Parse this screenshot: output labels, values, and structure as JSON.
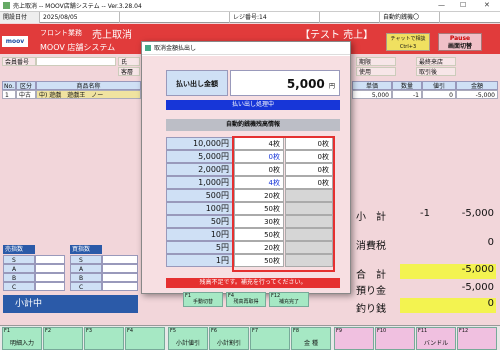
{
  "window": {
    "title": "売上取消 -- MOOV店舗システム -- Ver.3.28.04",
    "min": "—",
    "max": "☐",
    "close": "✕"
  },
  "infobar": {
    "date_label": "開設日付",
    "date": "2025/08/05",
    "register": "レジ番号:14",
    "atm_status": "自動釣銭機〇"
  },
  "header": {
    "logo": "moov",
    "dept": "フロント業務",
    "screen": "売上取消",
    "system": "MOOV 店舗システム",
    "test_label": "【テスト 売上】",
    "chat_line1": "チャットで相談",
    "chat_line2": "Ctrl+3",
    "pause_line1": "Pause",
    "pause_line2": "画面切替"
  },
  "customer": {
    "member_no": "会員番号",
    "name_partial": "氏",
    "guest": "客層",
    "deadline": "期限",
    "last_visit": "最終来店",
    "usage": "使用",
    "transactions": "取引後"
  },
  "table": {
    "headers": [
      "No.",
      "区分",
      "商品名称",
      "単価",
      "数量",
      "値引",
      "金額"
    ],
    "row": [
      "1",
      "中古",
      "中) 遊戯　遊戯王　ノー",
      "5,000",
      "-1",
      "0",
      "-5,000"
    ]
  },
  "sales_box": {
    "title": "売指数",
    "rows": [
      "S",
      "A",
      "B",
      "C"
    ]
  },
  "buy_box": {
    "title": "買指数",
    "rows": [
      "S",
      "A",
      "B",
      "C"
    ]
  },
  "subtotal_bar": "小計中",
  "summary": {
    "subtotal_label": "小　計",
    "subtotal_qty": "-1",
    "subtotal_val": "-5,000",
    "tax_label": "消費税",
    "tax_val": "0",
    "total_label": "合　計",
    "total_val": "-5,000",
    "deposit_label": "預り金",
    "deposit_val": "-5,000",
    "change_label": "釣り銭",
    "change_val": "0"
  },
  "fkeys": [
    {
      "num": "F1",
      "label": "明細入力"
    },
    {
      "num": "F2",
      "label": ""
    },
    {
      "num": "F3",
      "label": ""
    },
    {
      "num": "F4",
      "label": ""
    },
    {
      "num": "F5",
      "label": "小計値引"
    },
    {
      "num": "F6",
      "label": "小計割引"
    },
    {
      "num": "F7",
      "label": ""
    },
    {
      "num": "F8",
      "label": "金 種"
    },
    {
      "num": "F9",
      "label": ""
    },
    {
      "num": "F10",
      "label": ""
    },
    {
      "num": "F11",
      "label": "バンドル"
    },
    {
      "num": "F12",
      "label": ""
    }
  ],
  "dialog": {
    "title": "取消金額払出し",
    "pay_label": "払い出し金額",
    "pay_amount": "5,000",
    "pay_unit": "円",
    "processing": "払い出し処理中",
    "balance_title": "自動釣銭機残高情報",
    "denominations": [
      {
        "label": "10,000円",
        "c1": "4枚",
        "c2": "0枚"
      },
      {
        "label": "5,000円",
        "c1": "0枚",
        "c2": "0枚"
      },
      {
        "label": "2,000円",
        "c1": "0枚",
        "c2": "0枚"
      },
      {
        "label": "1,000円",
        "c1": "4枚",
        "c2": "0枚"
      },
      {
        "label": "500円",
        "c1": "20枚",
        "c2": ""
      },
      {
        "label": "100円",
        "c1": "50枚",
        "c2": ""
      },
      {
        "label": "50円",
        "c1": "30枚",
        "c2": ""
      },
      {
        "label": "10円",
        "c1": "50枚",
        "c2": ""
      },
      {
        "label": "5円",
        "c1": "20枚",
        "c2": ""
      },
      {
        "label": "1円",
        "c1": "50枚",
        "c2": ""
      }
    ],
    "warning": "残高不足です。補充を行ってください。",
    "buttons": [
      {
        "num": "F1",
        "label": "手動切替"
      },
      {
        "num": "F4",
        "label": "残高再取得"
      },
      {
        "num": "F12",
        "label": "補充完了"
      }
    ]
  }
}
